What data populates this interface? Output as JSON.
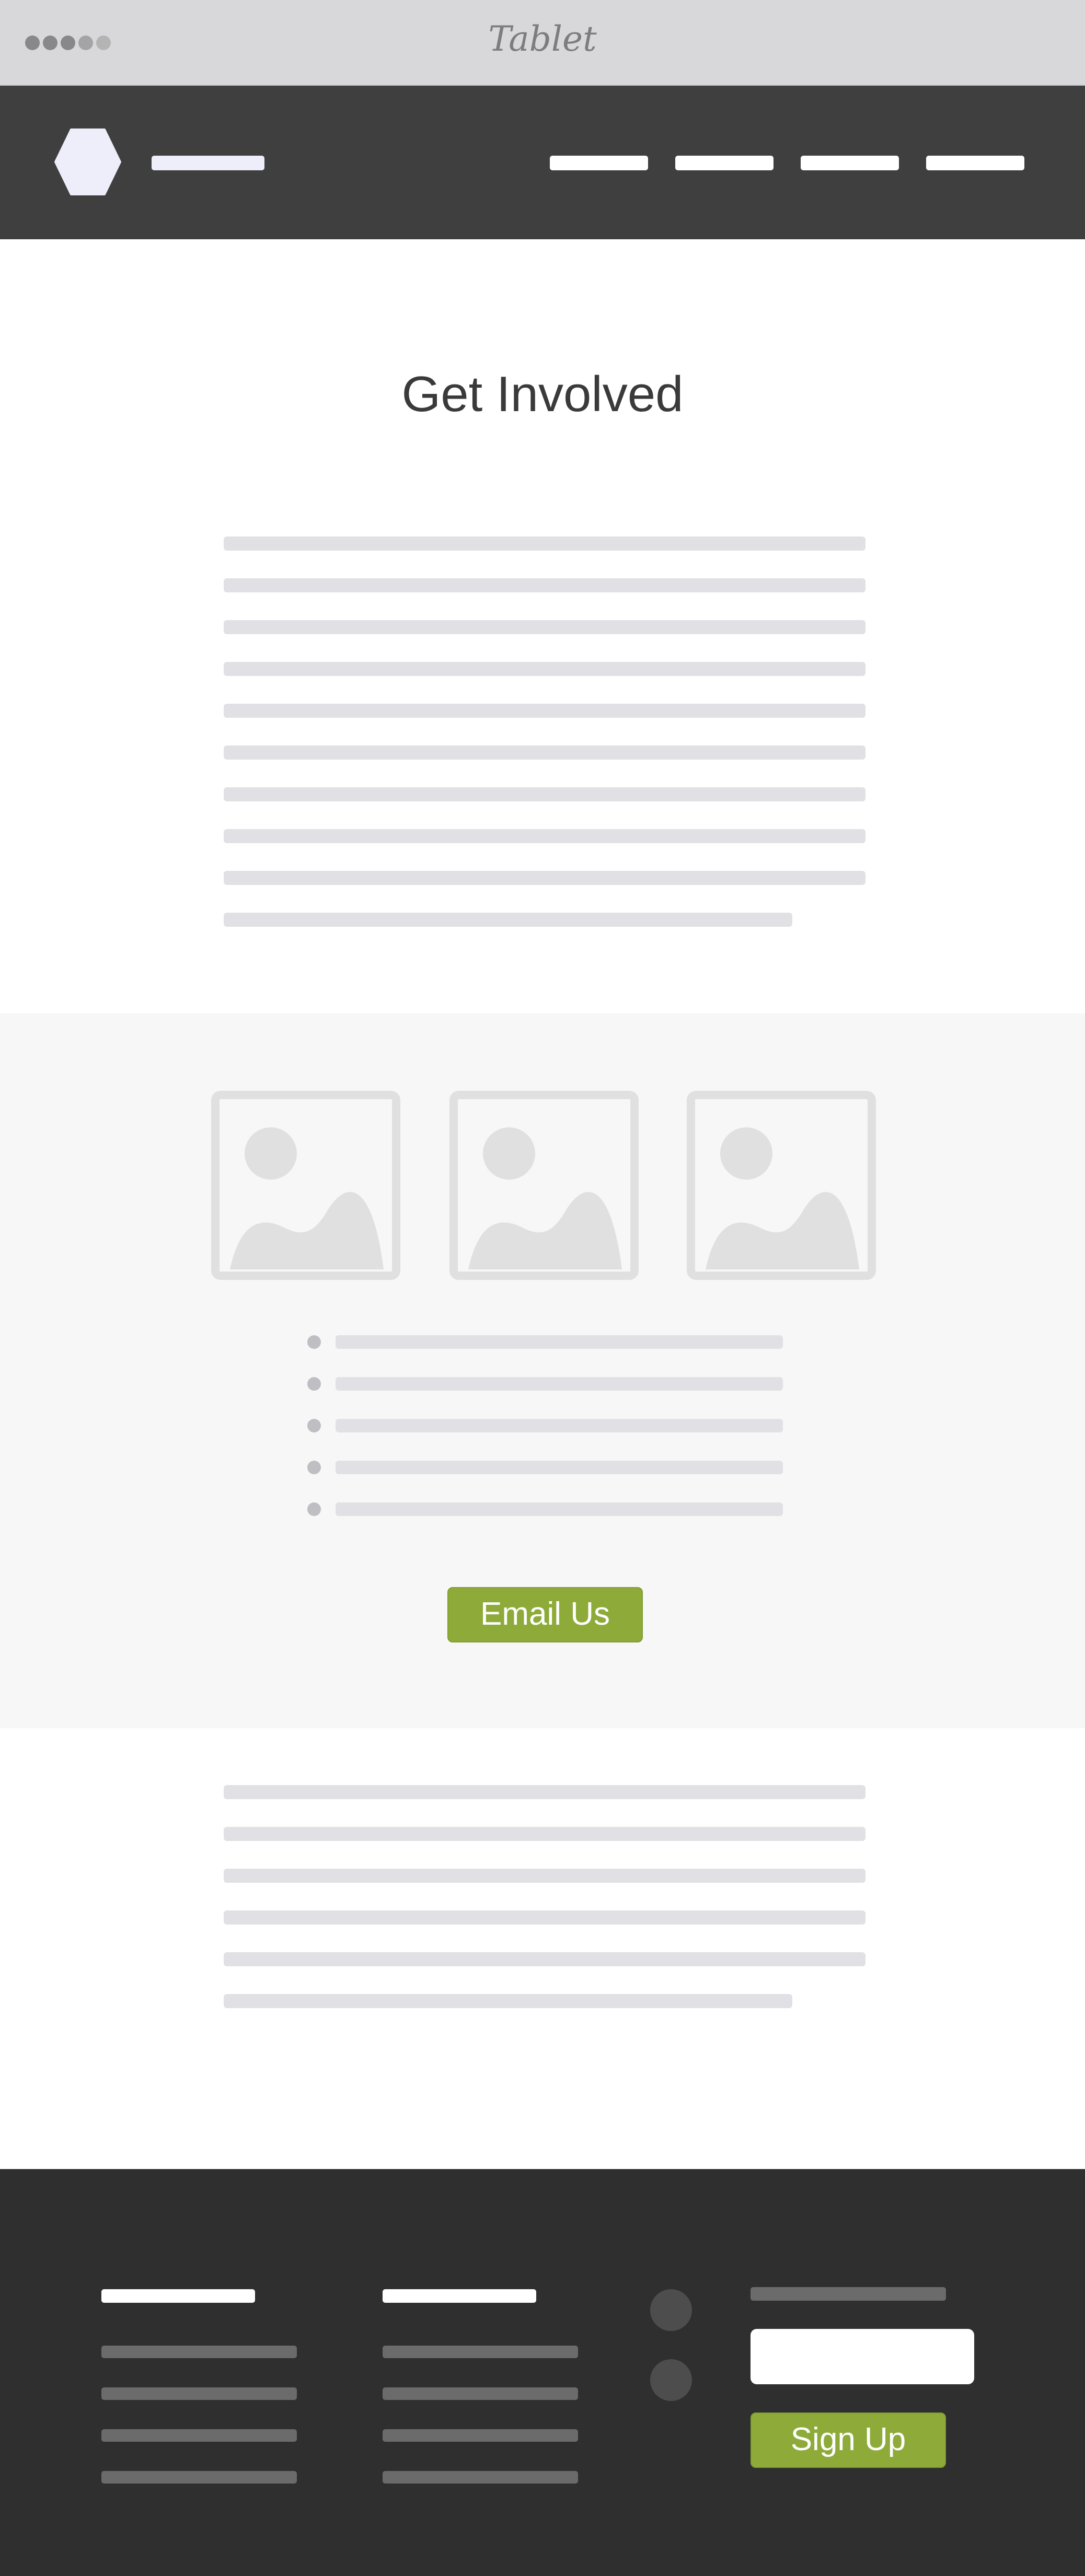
{
  "device": {
    "title": "Tablet",
    "dot_colors": [
      "#888888",
      "#888888",
      "#888888",
      "#a4a4a4",
      "#b4b4b4"
    ]
  },
  "header": {
    "logo_icon": "hexagon-logo-icon",
    "logo_color": "#eeeefb",
    "nav_item_count_visible": 4
  },
  "intro": {
    "title": "Get Involved"
  },
  "gallery": {
    "image_icon": "image-placeholder-icon",
    "cta_label": "Email Us"
  },
  "footer": {
    "signup_label": "Sign Up",
    "social_icon": "social-circle-icon"
  },
  "colors": {
    "accent": "#8eab3a",
    "header_bg": "#3f3f3f",
    "footer_bg": "#2f2f2f",
    "placeholder_line": "#e1e1e5"
  }
}
